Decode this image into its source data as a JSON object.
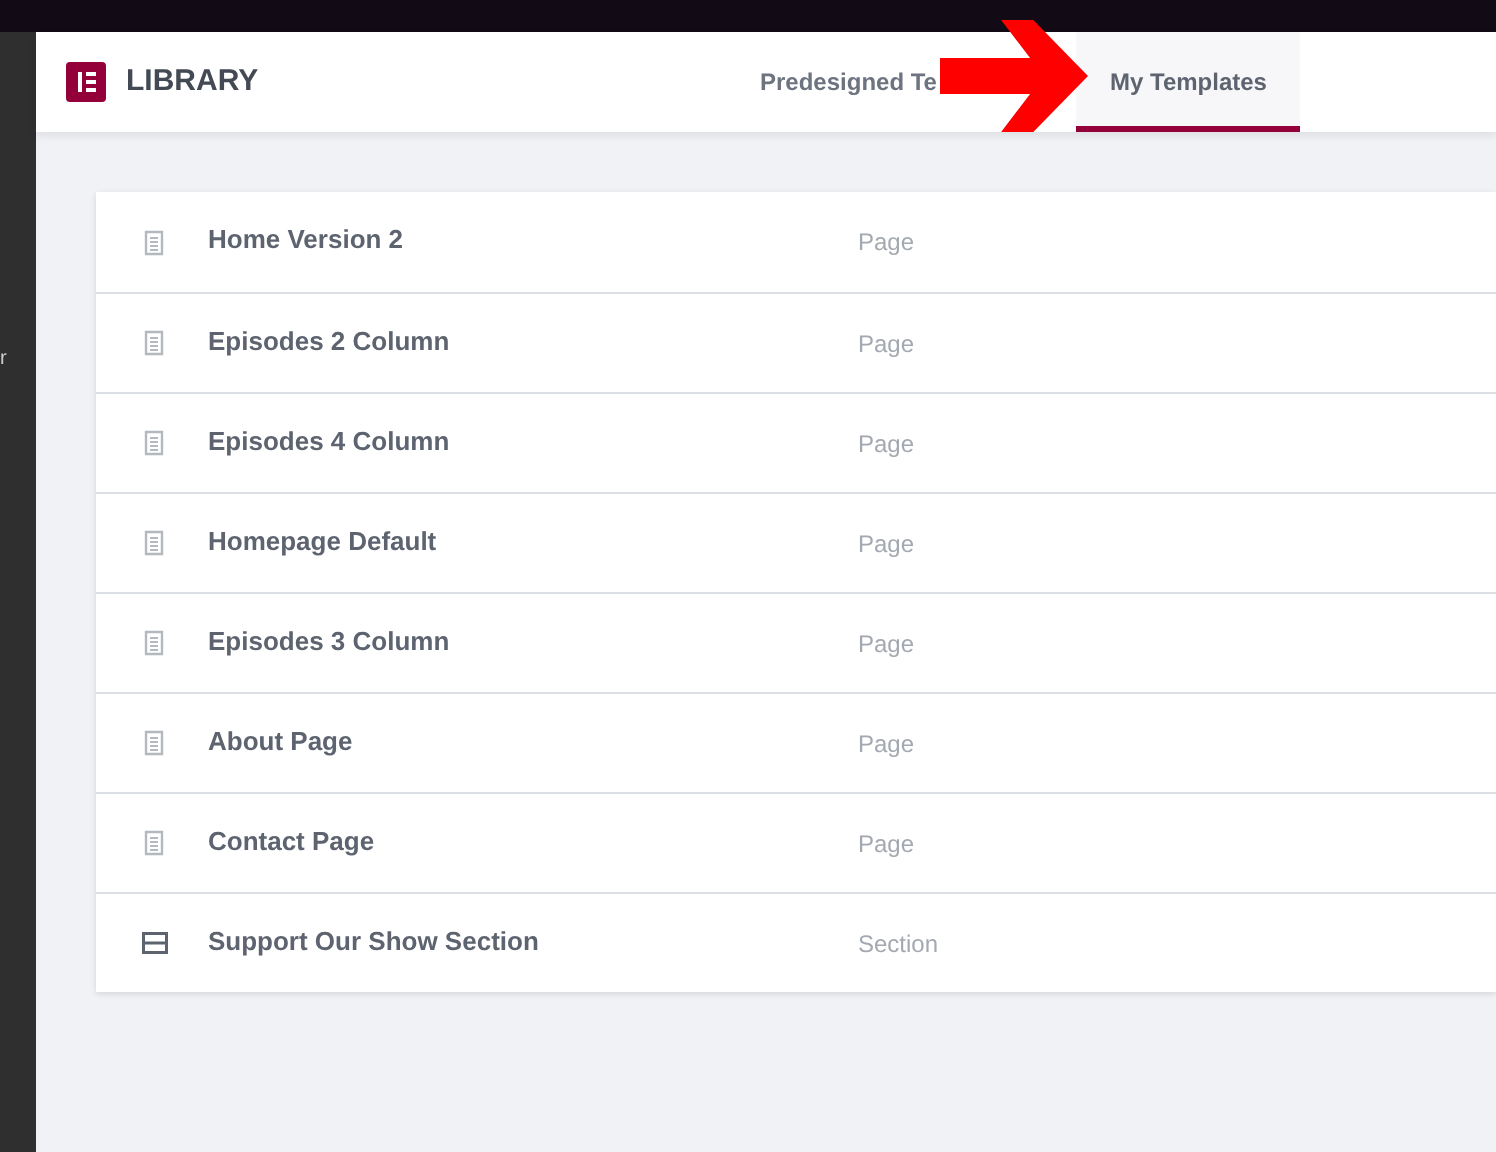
{
  "backdrop_text": "r",
  "header": {
    "title": "LIBRARY"
  },
  "tabs": [
    {
      "label": "Predesigned Te",
      "selected": false
    },
    {
      "label": "My Templates",
      "selected": true
    }
  ],
  "templates": [
    {
      "name": "Home Version 2",
      "type": "Page",
      "kind": "page"
    },
    {
      "name": "Episodes 2 Column",
      "type": "Page",
      "kind": "page"
    },
    {
      "name": "Episodes 4 Column",
      "type": "Page",
      "kind": "page"
    },
    {
      "name": "Homepage Default",
      "type": "Page",
      "kind": "page"
    },
    {
      "name": "Episodes 3 Column",
      "type": "Page",
      "kind": "page"
    },
    {
      "name": "About Page",
      "type": "Page",
      "kind": "page"
    },
    {
      "name": "Contact Page",
      "type": "Page",
      "kind": "page"
    },
    {
      "name": "Support Our Show Section",
      "type": "Section",
      "kind": "section"
    }
  ]
}
